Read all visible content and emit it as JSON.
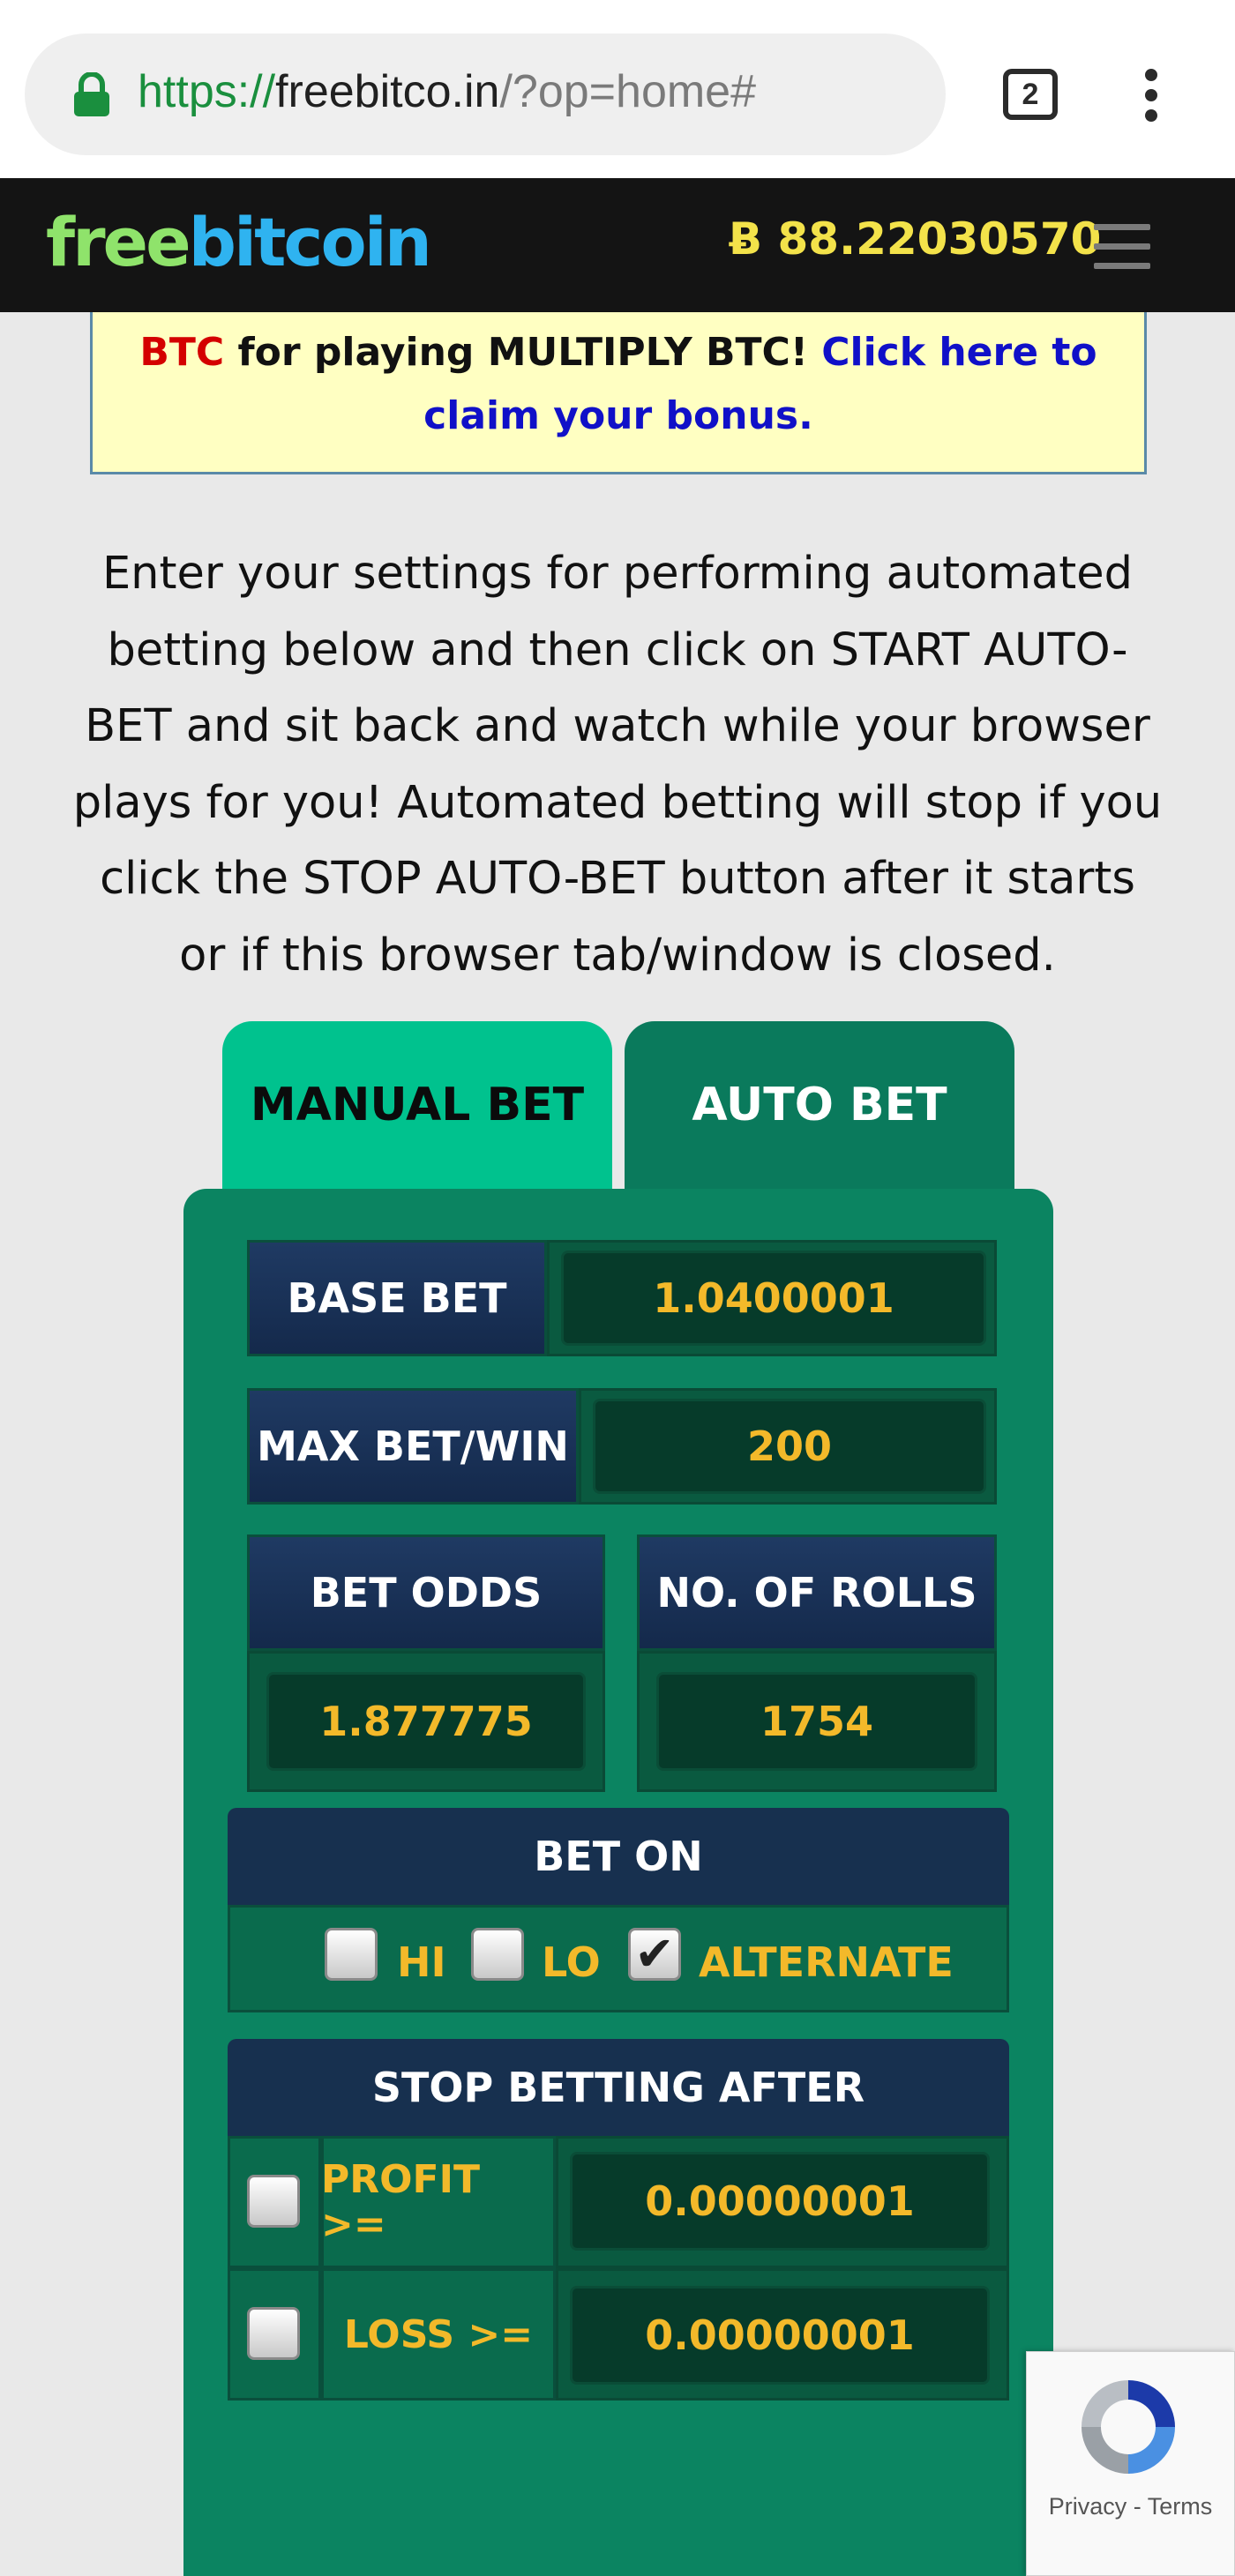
{
  "browser": {
    "url_scheme": "https://",
    "url_host": "freebitco.in",
    "url_path": "/?op=home#",
    "tab_count": "2"
  },
  "header": {
    "logo_free": "free",
    "logo_bitcoin": "bitcoin",
    "balance": "Ƀ 88.22030570"
  },
  "notice": {
    "btc": "BTC",
    "text": " for playing MULTIPLY BTC! ",
    "link": "Click here to claim your bonus."
  },
  "description": "Enter your settings for performing automated betting below and then click on START AUTO-BET and sit back and watch while your browser plays for you! Automated betting will stop if you click the STOP AUTO-BET button after it starts or if this browser tab/window is closed.",
  "tabs": {
    "manual": "MANUAL BET",
    "auto": "AUTO BET"
  },
  "form": {
    "base_bet_label": "BASE BET",
    "base_bet_value": "1.0400001",
    "max_bet_label": "MAX BET/WIN",
    "max_bet_value": "200",
    "bet_odds_label": "BET ODDS",
    "bet_odds_value": "1.877775",
    "rolls_label": "NO. OF ROLLS",
    "rolls_value": "1754",
    "bet_on_label": "BET ON",
    "bet_on_hi": "HI",
    "bet_on_lo": "LO",
    "bet_on_alternate": "ALTERNATE",
    "bet_on_selected": "ALTERNATE",
    "stop_label": "STOP BETTING AFTER",
    "profit_label": "PROFIT >=",
    "profit_value": "0.00000001",
    "loss_label": "LOSS >=",
    "loss_value": "0.00000001"
  },
  "recaptcha": {
    "terms": "Privacy - Terms"
  },
  "colors": {
    "panel": "#0b8461",
    "manual_tab": "#00c28e",
    "value_text": "#f3b92a",
    "label_bg": "#1f3a63"
  }
}
